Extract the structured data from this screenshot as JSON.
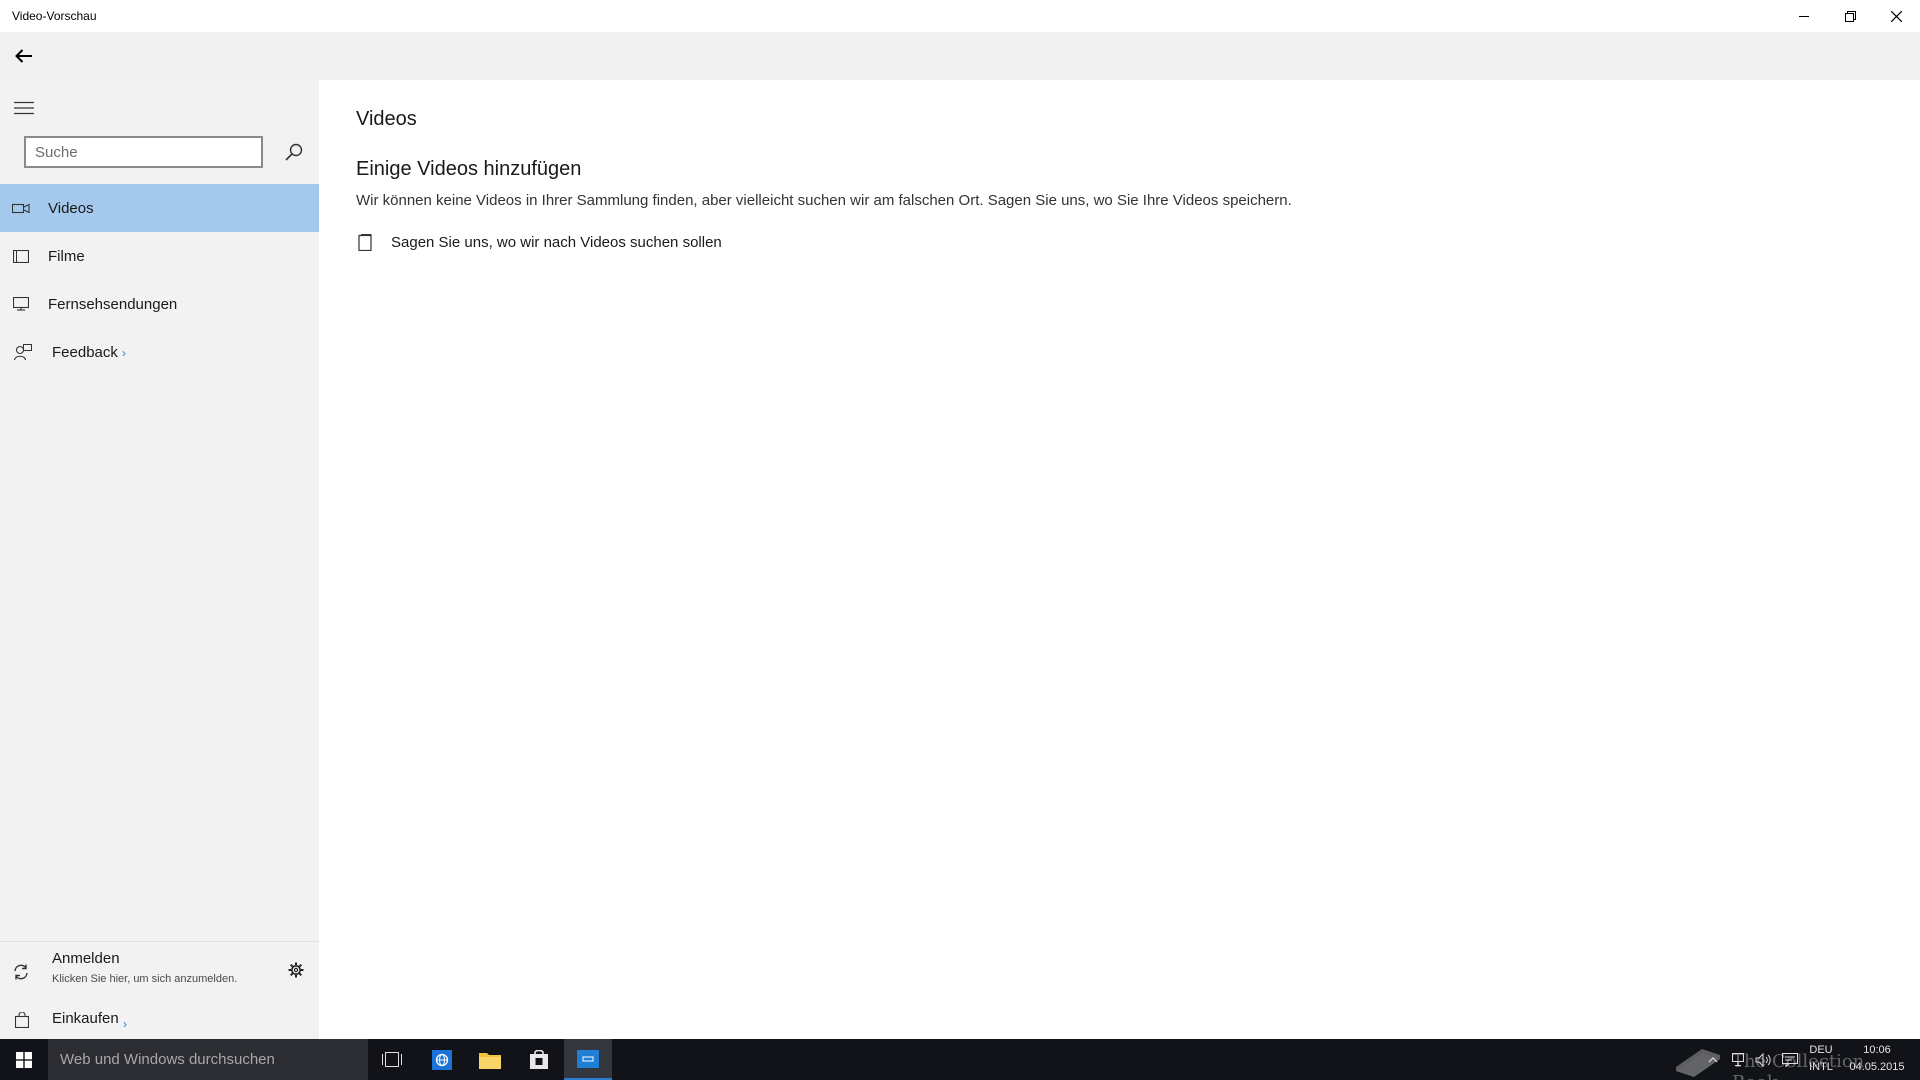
{
  "window": {
    "title": "Video-Vorschau"
  },
  "sidebar": {
    "search_placeholder": "Suche",
    "items": [
      {
        "label": "Videos",
        "icon": "video-camera-icon",
        "selected": true
      },
      {
        "label": "Filme",
        "icon": "film-icon",
        "selected": false
      },
      {
        "label": "Fernsehsendungen",
        "icon": "tv-icon",
        "selected": false
      },
      {
        "label": "Feedback",
        "icon": "feedback-icon",
        "selected": false,
        "chevron": "›"
      }
    ],
    "signin": {
      "title": "Anmelden",
      "subtitle": "Klicken Sie hier, um sich anzumelden."
    },
    "shop": {
      "label": "Einkaufen",
      "chevron": "›"
    }
  },
  "main": {
    "title": "Videos",
    "subheading": "Einige Videos hinzufügen",
    "description": "Wir können keine Videos in Ihrer Sammlung finden, aber vielleicht suchen wir am falschen Ort. Sagen Sie uns, wo Sie Ihre Videos speichern.",
    "link": "Sagen Sie uns, wo wir nach Videos suchen sollen"
  },
  "taskbar": {
    "search_text": "Web und Windows durchsuchen",
    "language": "DEU",
    "layout": "INTL",
    "time": "10:06",
    "date": "04.05.2015",
    "watermark": "The Collection Book"
  },
  "colors": {
    "selected_bg": "#a4c9ec",
    "sidebar_bg": "#f2f2f2",
    "accent": "#2b7cd3",
    "taskbar_bg": "#111318"
  }
}
